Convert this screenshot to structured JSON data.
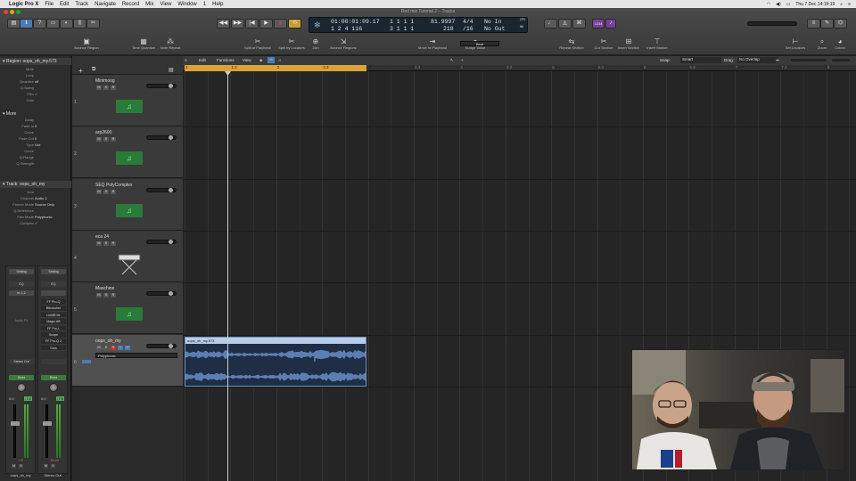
{
  "menubar": {
    "app": "Logic Pro X",
    "items": [
      "File",
      "Edit",
      "Track",
      "Navigate",
      "Record",
      "Mix",
      "View",
      "Window",
      "1",
      "Help"
    ],
    "clock": "Thu 7 Dec  14:19:19"
  },
  "window": {
    "title": "Red mix Tutorial 2 – Tracks"
  },
  "lcd": {
    "time": "01:00:01:09.17",
    "bars_top": "1  1  1      1",
    "bars_bottom": "1  2  4  116",
    "pos2_top": "1  1  1      1",
    "pos2_bottom": "3  1  1      1",
    "tempo": "81.9997",
    "tempo_sub": "218",
    "sig": "4/4",
    "sig_sub": "/16",
    "in": "No In",
    "out": "No Out",
    "cpu": "CPU",
    "hd": "HD"
  },
  "toolbar": {
    "tools": [
      {
        "name": "Bounce Region",
        "icon": "▣"
      },
      {
        "name": "Time Quantize",
        "icon": "▦"
      },
      {
        "name": "Note Repeat",
        "icon": "⁂"
      },
      {
        "name": "Split at Playhead",
        "icon": "✂"
      },
      {
        "name": "Split by Locators",
        "icon": "✂"
      },
      {
        "name": "Join",
        "icon": "⊕"
      },
      {
        "name": "Bounce Regions",
        "icon": "⇲"
      },
      {
        "name": "Move to Playhead",
        "icon": "⇥"
      },
      {
        "name": "Nudge Value",
        "icon": "◂▸"
      },
      {
        "name": "Repeat Section",
        "icon": "⇆"
      },
      {
        "name": "Cut Section",
        "icon": "✂"
      },
      {
        "name": "Insert Section",
        "icon": "⊞"
      },
      {
        "name": "Insert Marker",
        "icon": "⊤"
      },
      {
        "name": "Set Locators",
        "icon": "⊢"
      },
      {
        "name": "Zoom",
        "icon": "⌕"
      },
      {
        "name": "Colors",
        "icon": "◕"
      }
    ],
    "nudge_value": "Beat",
    "lcd_mode": "1234"
  },
  "arrange_header": {
    "edit": "Edit",
    "functions": "Functions",
    "view": "View",
    "snap_label": "Snap:",
    "snap_value": "Smart",
    "drag_label": "Drag:",
    "drag_value": "No Overlap"
  },
  "ruler": {
    "labels": [
      "1",
      "1.3",
      "2",
      "2.3",
      "3",
      "3.3",
      "4",
      "4.3",
      "5",
      "5.3",
      "6",
      "6.3",
      "7",
      "7.3",
      "8"
    ]
  },
  "inspector": {
    "region_header": "Region: oops_oh_my.573",
    "region_rows": [
      {
        "k": "Mute",
        "v": ""
      },
      {
        "k": "Loop",
        "v": ""
      },
      {
        "k": "Quantize",
        "v": "off"
      },
      {
        "k": "Q-Swing",
        "v": ""
      },
      {
        "k": "Flex",
        "v": "✓"
      },
      {
        "k": "Gain",
        "v": ""
      }
    ],
    "more_header": "More",
    "more_rows": [
      {
        "k": "Delay",
        "v": ""
      },
      {
        "k": "Fade In",
        "v": "0"
      },
      {
        "k": "Curve",
        "v": ""
      },
      {
        "k": "Fade Out",
        "v": "0"
      },
      {
        "k": "Type",
        "v": "Out"
      },
      {
        "k": "Curve",
        "v": ""
      },
      {
        "k": "Q-Range",
        "v": ""
      },
      {
        "k": "Q-Strength",
        "v": ""
      }
    ],
    "track_header": "Track: oops_oh_my",
    "track_rows": [
      {
        "k": "Icon",
        "v": ""
      },
      {
        "k": "Channel",
        "v": "Audio 2"
      },
      {
        "k": "Freeze Mode",
        "v": "Source Only"
      },
      {
        "k": "Q-Reference",
        "v": ""
      },
      {
        "k": "Flex Mode",
        "v": "Polyphonic"
      },
      {
        "k": "Complex",
        "v": "✓"
      }
    ]
  },
  "strips": [
    {
      "setting": "Setting",
      "eq": "EQ",
      "input": "In 1-2",
      "audio_fx": "Audio FX",
      "plugins": [],
      "output": "Stereo Out",
      "automation": "Read",
      "pan": "0.0",
      "peak": "-7.2",
      "mute": "M",
      "solo": "S",
      "name": "oops_oh_my",
      "ir": "I  R"
    },
    {
      "setting": "Setting",
      "eq": "EQ",
      "input": "",
      "plugins": [
        "FF Pro-Q",
        "Bitcrusher",
        "LinMB Mr",
        "Magic AB",
        "FF Pro-L",
        "Scope",
        "FF Pro-Q 2",
        "Gain"
      ],
      "output": "",
      "automation": "Read",
      "pan": "0.0",
      "peak": "-7.5",
      "mute": "M",
      "solo": "S",
      "name": "Stereo Out",
      "ir": "Bnce"
    }
  ],
  "tracks": [
    {
      "num": "1",
      "name": "Minimoog",
      "icon": "♫"
    },
    {
      "num": "2",
      "name": "arp2600",
      "icon": "♫"
    },
    {
      "num": "3",
      "name": "SEQ PolyComplex",
      "icon": "♫"
    },
    {
      "num": "4",
      "name": "eca 24",
      "icon": "keyboard"
    },
    {
      "num": "5",
      "name": "Maschine",
      "icon": "♫"
    },
    {
      "num": "6",
      "name": "oops_oh_my",
      "icon": "",
      "preset": "Polyphonic"
    }
  ],
  "region": {
    "name": "oops_oh_my.573"
  }
}
